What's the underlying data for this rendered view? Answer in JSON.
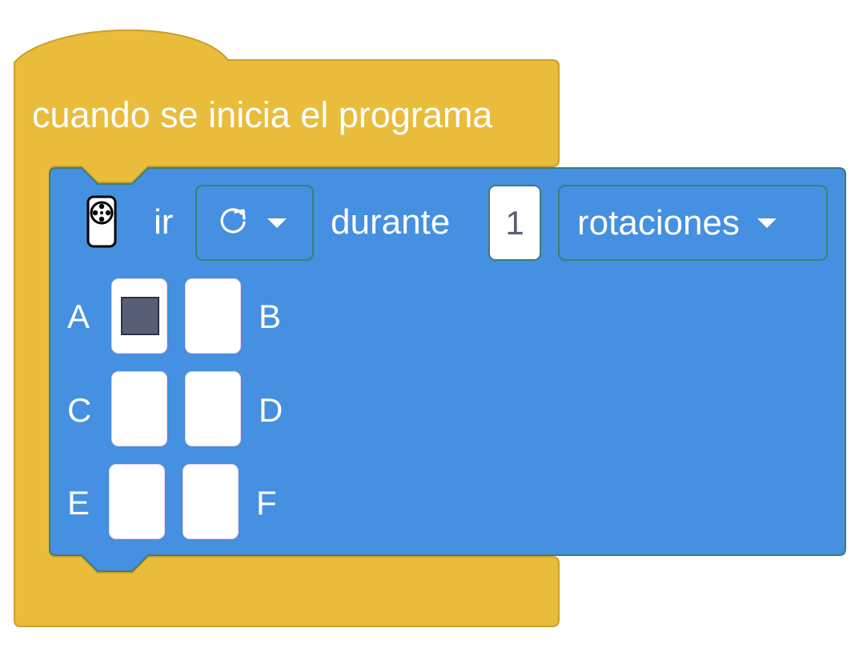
{
  "hat_block": {
    "label": "cuando se inicia el programa",
    "color": "#e9bc3c"
  },
  "motor_block": {
    "color": "#4590e0",
    "icon": "motor-icon",
    "verb": "ir",
    "direction_icon": "clockwise-arrow-icon",
    "connector": "durante",
    "amount": "1",
    "unit": "rotaciones",
    "ports": [
      {
        "left": "A",
        "right": "B",
        "left_selected": true,
        "right_selected": false
      },
      {
        "left": "C",
        "right": "D",
        "left_selected": false,
        "right_selected": false
      },
      {
        "left": "E",
        "right": "F",
        "left_selected": false,
        "right_selected": false
      }
    ]
  }
}
